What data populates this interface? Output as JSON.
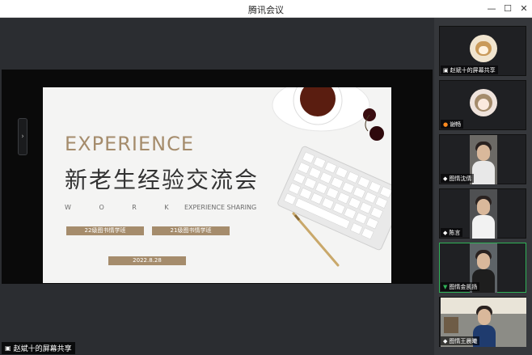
{
  "window": {
    "title": "腾讯会议",
    "min": "—",
    "max": "☐",
    "close": "✕"
  },
  "slide": {
    "heading_en": "EXPERIENCE",
    "heading_cn": "新老生经验交流会",
    "sub_letters": "W O R K",
    "sub_rest": "EXPERIENCE SHARING",
    "tag1": "22级图书情学班",
    "tag2": "21级图书情学班",
    "date": "2022.8.28"
  },
  "share_label": "赵斌十的屏幕共享",
  "participants": [
    {
      "name": "赵斌十的屏幕共享",
      "icon": "▣"
    },
    {
      "name": "谢畅",
      "icon": "●"
    },
    {
      "name": "图情沈倩",
      "icon": "◆"
    },
    {
      "name": "陈言",
      "icon": "◆"
    },
    {
      "name": "图情金凯扬",
      "icon": "▼"
    },
    {
      "name": "图情王晨曦",
      "icon": "◆"
    }
  ],
  "colors": {
    "accent": "#a58c6c",
    "active_border": "#2fb257"
  }
}
